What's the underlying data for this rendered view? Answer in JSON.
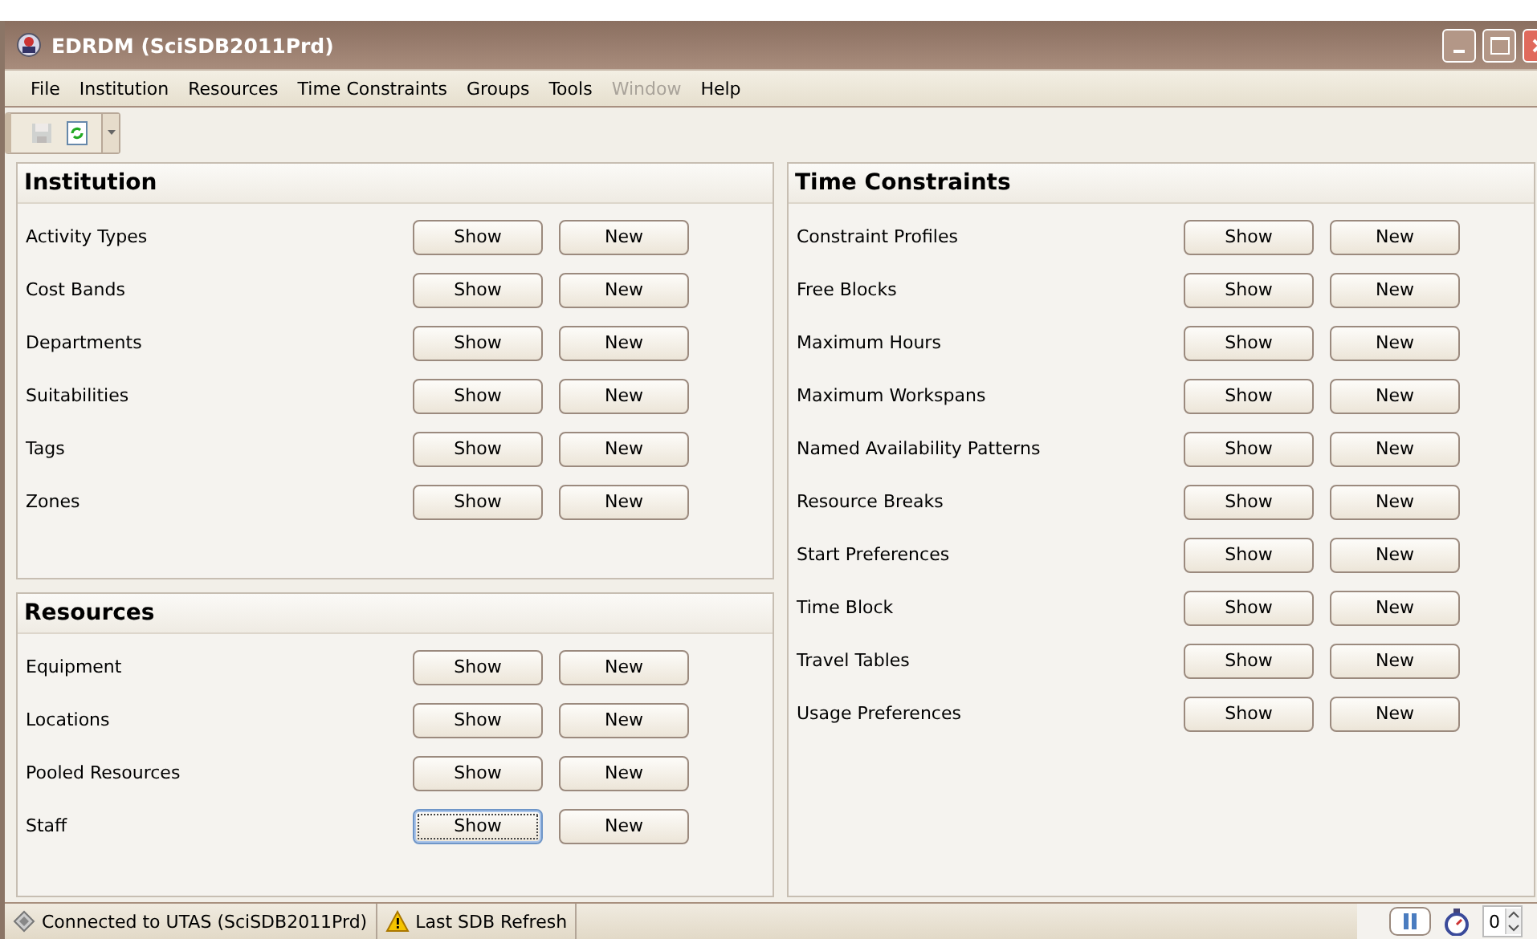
{
  "window": {
    "title": "EDRDM (SciSDB2011Prd)"
  },
  "menu": [
    {
      "label": "File",
      "disabled": false
    },
    {
      "label": "Institution",
      "disabled": false
    },
    {
      "label": "Resources",
      "disabled": false
    },
    {
      "label": "Time Constraints",
      "disabled": false
    },
    {
      "label": "Groups",
      "disabled": false
    },
    {
      "label": "Tools",
      "disabled": false
    },
    {
      "label": "Window",
      "disabled": true
    },
    {
      "label": "Help",
      "disabled": false
    }
  ],
  "toolbar": [
    {
      "kind": "save",
      "disabled": true
    },
    {
      "kind": "refresh",
      "disabled": false
    }
  ],
  "panels": [
    {
      "title": "Institution",
      "rows": [
        {
          "label": "Activity Types",
          "show": "Show",
          "new": "New",
          "focused": false
        },
        {
          "label": "Cost Bands",
          "show": "Show",
          "new": "New",
          "focused": false
        },
        {
          "label": "Departments",
          "show": "Show",
          "new": "New",
          "focused": false
        },
        {
          "label": "Suitabilities",
          "show": "Show",
          "new": "New",
          "focused": false
        },
        {
          "label": "Tags",
          "show": "Show",
          "new": "New",
          "focused": false
        },
        {
          "label": "Zones",
          "show": "Show",
          "new": "New",
          "focused": false
        }
      ]
    },
    {
      "title": "Resources",
      "rows": [
        {
          "label": "Equipment",
          "show": "Show",
          "new": "New",
          "focused": false
        },
        {
          "label": "Locations",
          "show": "Show",
          "new": "New",
          "focused": false
        },
        {
          "label": "Pooled Resources",
          "show": "Show",
          "new": "New",
          "focused": false
        },
        {
          "label": "Staff",
          "show": "Show",
          "new": "New",
          "focused": true
        }
      ]
    },
    {
      "title": "Time Constraints",
      "rows": [
        {
          "label": "Constraint Profiles",
          "show": "Show",
          "new": "New",
          "focused": false
        },
        {
          "label": "Free Blocks",
          "show": "Show",
          "new": "New",
          "focused": false
        },
        {
          "label": "Maximum Hours",
          "show": "Show",
          "new": "New",
          "focused": false
        },
        {
          "label": "Maximum Workspans",
          "show": "Show",
          "new": "New",
          "focused": false
        },
        {
          "label": "Named Availability Patterns",
          "show": "Show",
          "new": "New",
          "focused": false
        },
        {
          "label": "Resource Breaks",
          "show": "Show",
          "new": "New",
          "focused": false
        },
        {
          "label": "Start Preferences",
          "show": "Show",
          "new": "New",
          "focused": false
        },
        {
          "label": "Time Block",
          "show": "Show",
          "new": "New",
          "focused": false
        },
        {
          "label": "Travel Tables",
          "show": "Show",
          "new": "New",
          "focused": false
        },
        {
          "label": "Usage Preferences",
          "show": "Show",
          "new": "New",
          "focused": false
        }
      ]
    }
  ],
  "status_bar": {
    "connection": "Connected to UTAS (SciSDB2011Prd)",
    "refresh": "Last SDB Refresh",
    "counter": "0"
  }
}
